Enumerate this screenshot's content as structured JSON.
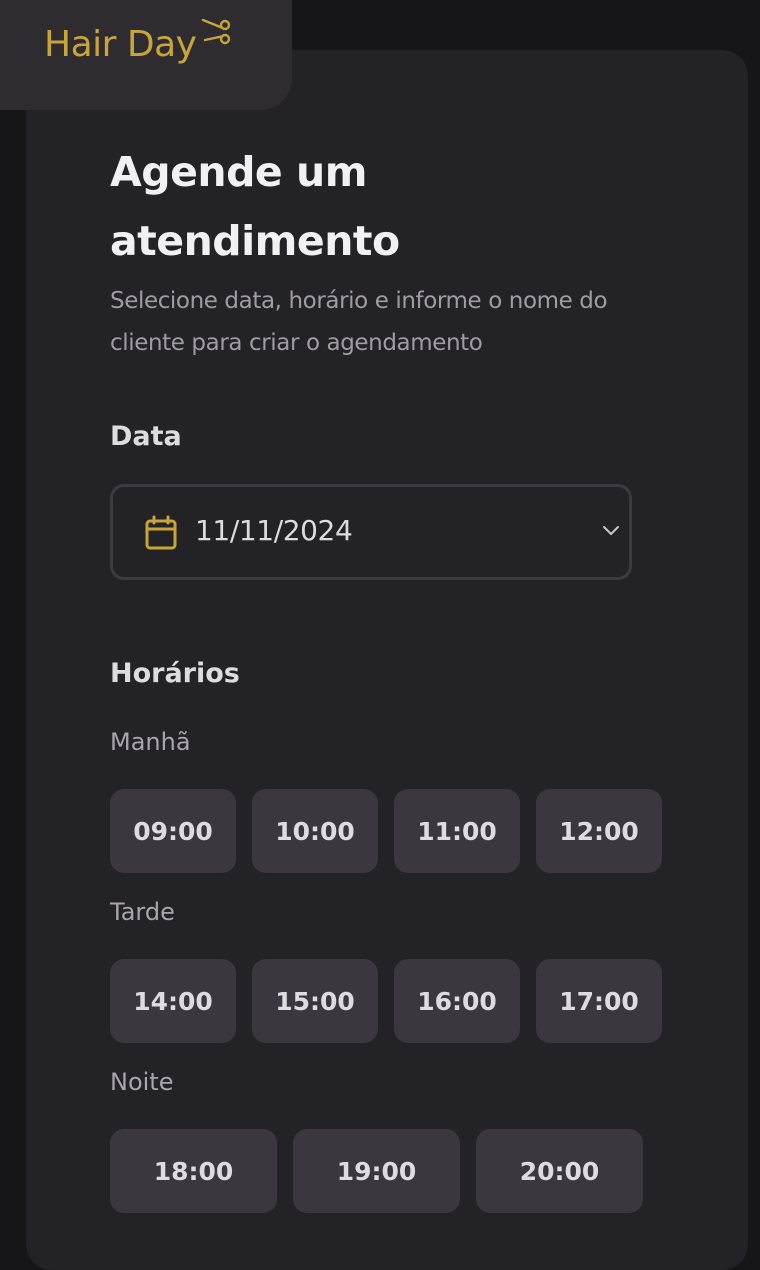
{
  "brand": {
    "name": "Hair Day",
    "icon": "scissors-icon",
    "color": "#c9a538"
  },
  "page": {
    "title": "Agende um atendimento",
    "subtitle": "Selecione data, horário e informe o nome do cliente para criar o agendamento"
  },
  "date": {
    "label": "Data",
    "value": "11/11/2024",
    "icon": "calendar-icon"
  },
  "schedule": {
    "label": "Horários",
    "morning": {
      "label": "Manhã",
      "times": [
        "09:00",
        "10:00",
        "11:00",
        "12:00"
      ]
    },
    "afternoon": {
      "label": "Tarde",
      "times": [
        "14:00",
        "15:00",
        "16:00",
        "17:00"
      ]
    },
    "night": {
      "label": "Noite",
      "times": [
        "18:00",
        "19:00",
        "20:00"
      ]
    }
  }
}
